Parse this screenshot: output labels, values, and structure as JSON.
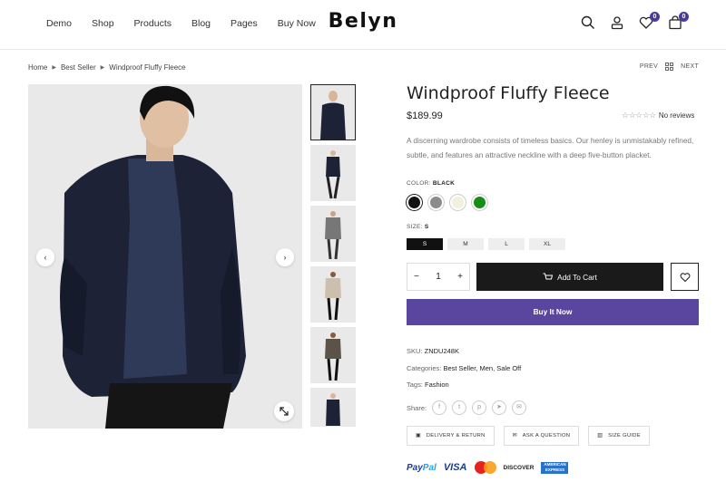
{
  "header": {
    "nav": [
      "Demo",
      "Shop",
      "Products",
      "Blog",
      "Pages",
      "Buy Now"
    ],
    "logo": "Belyn",
    "wishlist_count": "0",
    "cart_count": "0"
  },
  "breadcrumb": [
    "Home",
    "Best Seller",
    "Windproof Fluffy Fleece"
  ],
  "pager": {
    "prev": "PREV",
    "next": "NEXT"
  },
  "product": {
    "title": "Windproof Fluffy Fleece",
    "price": "$189.99",
    "reviews": "No reviews",
    "description": "A discerning wardrobe consists of timeless basics. Our henley is unmistakably refined, subtle, and features an attractive neckline with a deep five-button placket.",
    "color_label": "COLOR:",
    "color_value": "BLACK",
    "colors": [
      "#111111",
      "#8c8c8c",
      "#f3f0df",
      "#178c17"
    ],
    "size_label": "SIZE:",
    "size_value": "S",
    "sizes": [
      "S",
      "M",
      "L",
      "XL"
    ],
    "quantity": "1",
    "add_to_cart": "Add To Cart",
    "buy_now": "Buy It Now",
    "sku_label": "SKU:",
    "sku": "ZNDU248K",
    "categories_label": "Categories:",
    "categories": "Best Seller, Men, Sale Off",
    "tags_label": "Tags:",
    "tags": "Fashion",
    "share_label": "Share:",
    "delivery": "DELIVERY & RETURN",
    "ask": "ASK A QUESTION",
    "size_guide": "SIZE GUIDE"
  },
  "payments": {
    "paypal_a": "Pay",
    "paypal_b": "Pal",
    "visa": "VISA",
    "discover": "DISCOVER",
    "amex": "AMERICAN EXPRESS"
  },
  "colors": {
    "accent": "#5a469f",
    "dark": "#1a1a1a"
  }
}
